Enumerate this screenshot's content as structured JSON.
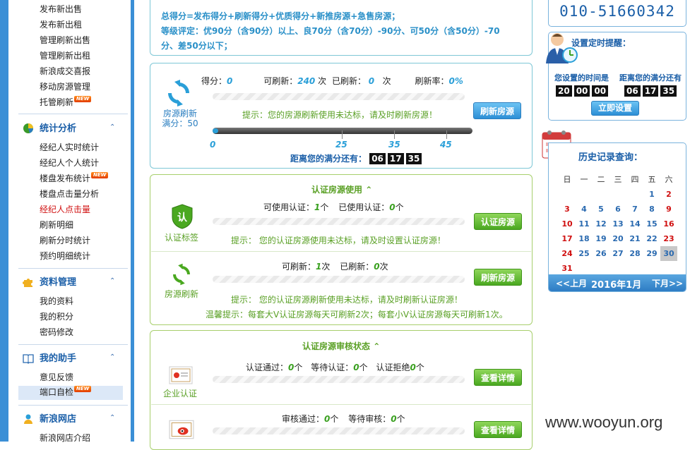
{
  "sidebar": {
    "top_items": [
      "发布新出售",
      "发布新出租",
      "管理刷新出售",
      "管理刷新出租",
      "新浪成交喜报",
      "移动房源管理",
      "托管刷新"
    ],
    "sections": [
      {
        "title": "统计分析",
        "items": [
          "经纪人实时统计",
          "经纪人个人统计",
          "楼盘发布统计",
          "楼盘点击量分析",
          "经纪人点击量",
          "刷新明细",
          "刷新分时统计",
          "预约明细统计"
        ]
      },
      {
        "title": "资料管理",
        "items": [
          "我的资料",
          "我的积分",
          "密码修改"
        ]
      },
      {
        "title": "我的助手",
        "items": [
          "意见反馈",
          "端口自检"
        ]
      },
      {
        "title": "新浪网店",
        "items": [
          "新浪网店介绍"
        ]
      }
    ],
    "new_badge": "NEW",
    "collapse_icon": "⌃"
  },
  "rules": {
    "line1": "总得分=发布得分+刷新得分+优质得分+新推房源+急售房源；",
    "line2": "等级评定：优90分（含90分）以上、良70分（含70分）-90分、可50分（含50分）-70",
    "line3": "分、差50分以下；"
  },
  "refresh": {
    "caption": "房源刷新",
    "full_score": "满分：50",
    "score_label": "得分：",
    "score": "0",
    "refreshable_label": "可刷新：",
    "refreshable": "240",
    "unit_times": "次",
    "refreshed_label": "已刷新：",
    "refreshed": "0",
    "rate_label": "刷新率：",
    "rate": "0%",
    "tip": "提示：您的房源刷新使用未达标，请及时刷新房源！",
    "button": "刷新房源",
    "ticks": [
      "0",
      "25",
      "35",
      "45"
    ],
    "countdown_label": "距离您的满分还有：",
    "countdown": [
      "06",
      "17",
      "35"
    ]
  },
  "cert_usage": {
    "title": "认证房源使用",
    "tag_caption": "认证标签",
    "available_label": "可使用认证：",
    "available": "1",
    "unit_count": "个",
    "used_label": "已使用认证：",
    "used": "0",
    "tip1": "提示：  您的认证房源使用未达标，请及时设置认证房源！",
    "button1": "认证房源",
    "refresh_caption": "房源刷新",
    "refreshable_label": "可刷新：",
    "refreshable": "1",
    "unit_times": "次",
    "refreshed_label": "已刷新：",
    "refreshed": "0",
    "tip2": "提示：  您的认证房源刷新使用未达标，请及时刷新认证房源！",
    "button2": "刷新房源",
    "warm_tip": "温馨提示：每套大V认证房源每天可刷新2次；每套小V认证房源每天可刷新1次。"
  },
  "cert_audit": {
    "title": "认证房源审核状态",
    "ent_caption": "企业认证",
    "passed_label": "认证通过：",
    "passed": "0",
    "waiting_label": "等待认证：",
    "waiting": "0",
    "rejected_label": "认证拒绝",
    "rejected": "0",
    "unit_count": "个",
    "button": "查看详情",
    "audit_passed_label": "审核通过：",
    "audit_passed": "0",
    "audit_waiting_label": "等待审核：",
    "audit_waiting": "0",
    "button2": "查看详情"
  },
  "right": {
    "phone": "010-51660342",
    "reminder_title": "设置定时提醒：",
    "set_time_label": "您设置的时间是",
    "remaining_label": "距离您的满分还有",
    "set_time": [
      "20",
      "00",
      "00"
    ],
    "remaining": [
      "06",
      "17",
      "35"
    ],
    "set_button": "立即设置",
    "history_title": "历史记录查询：",
    "weekdays": [
      "日",
      "一",
      "二",
      "三",
      "四",
      "五",
      "六"
    ],
    "prev": "<<上月",
    "month": "2016年1月",
    "next": "下月>>"
  },
  "calendar": {
    "weeks": [
      [
        "",
        "",
        "",
        "",
        "",
        "1",
        "2"
      ],
      [
        "3",
        "4",
        "5",
        "6",
        "7",
        "8",
        "9"
      ],
      [
        "10",
        "11",
        "12",
        "13",
        "14",
        "15",
        "16"
      ],
      [
        "17",
        "18",
        "19",
        "20",
        "21",
        "22",
        "23"
      ],
      [
        "24",
        "25",
        "26",
        "27",
        "28",
        "29",
        "30"
      ],
      [
        "31",
        "",
        "",
        "",
        "",
        "",
        ""
      ]
    ],
    "today": "30"
  },
  "watermark": "www.wooyun.org",
  "colors": {
    "accent": "#2a9fd8",
    "green": "#5aa025",
    "red": "#d01010",
    "sidebar": "#3b8fd6"
  }
}
